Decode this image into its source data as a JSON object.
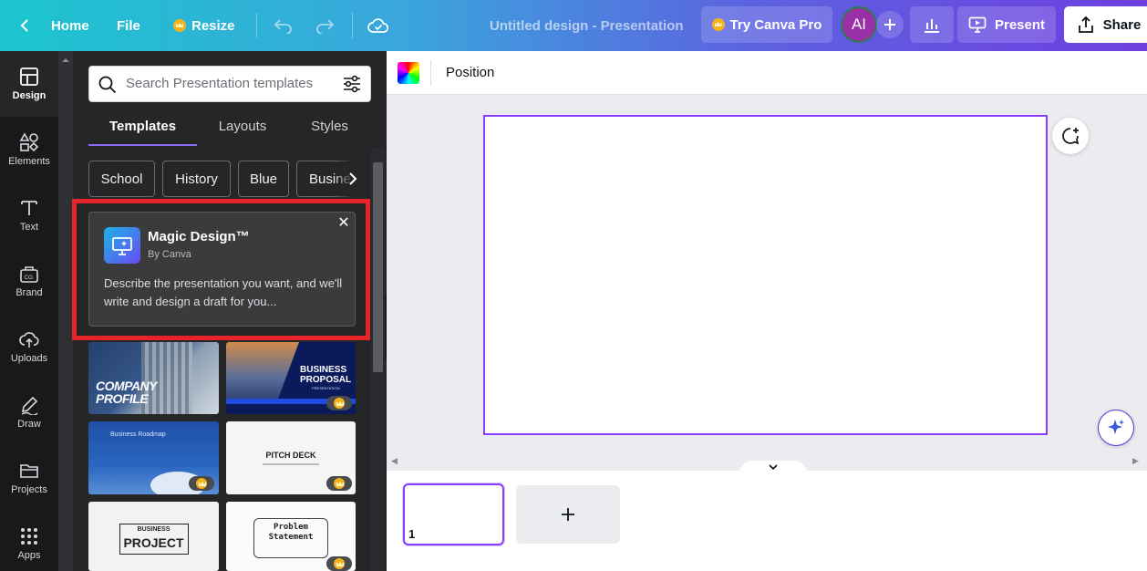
{
  "topbar": {
    "home_label": "Home",
    "file_label": "File",
    "resize_label": "Resize",
    "doc_title": "Untitled design - Presentation",
    "try_pro_label": "Try Canva Pro",
    "avatar_initials": "AI",
    "present_label": "Present",
    "share_label": "Share"
  },
  "rail": {
    "items": [
      {
        "label": "Design",
        "icon": "layout-icon"
      },
      {
        "label": "Elements",
        "icon": "shapes-icon"
      },
      {
        "label": "Text",
        "icon": "text-icon"
      },
      {
        "label": "Brand",
        "icon": "brand-icon"
      },
      {
        "label": "Uploads",
        "icon": "cloud-upload-icon"
      },
      {
        "label": "Draw",
        "icon": "pen-icon"
      },
      {
        "label": "Projects",
        "icon": "folder-icon"
      },
      {
        "label": "Apps",
        "icon": "grid-icon"
      }
    ]
  },
  "panel": {
    "search_placeholder": "Search Presentation templates",
    "tabs": [
      "Templates",
      "Layouts",
      "Styles"
    ],
    "chips": [
      "School",
      "History",
      "Blue",
      "Busine"
    ],
    "magic": {
      "title": "Magic Design™",
      "by": "By Canva",
      "description": "Describe the presentation you want, and we'll write and design a draft for you..."
    },
    "templates": [
      {
        "line1": "COMPANY",
        "line2": "PROFILE",
        "pro": false
      },
      {
        "line1": "BUSINESS",
        "line2": "PROPOSAL",
        "line3": "PRESENTATION",
        "pro": true
      },
      {
        "line1": "Business Roadmap",
        "pro": true
      },
      {
        "line1": "PITCH DECK",
        "pro": true
      },
      {
        "line1": "BUSINESS",
        "line2": "PROJECT",
        "pro": false
      },
      {
        "line1": "Problem",
        "line2": "Statement",
        "pro": true
      }
    ]
  },
  "editor": {
    "position_label": "Position",
    "page_number": "1"
  },
  "colors": {
    "accent": "#8b3dff",
    "highlight": "#e8232a"
  }
}
